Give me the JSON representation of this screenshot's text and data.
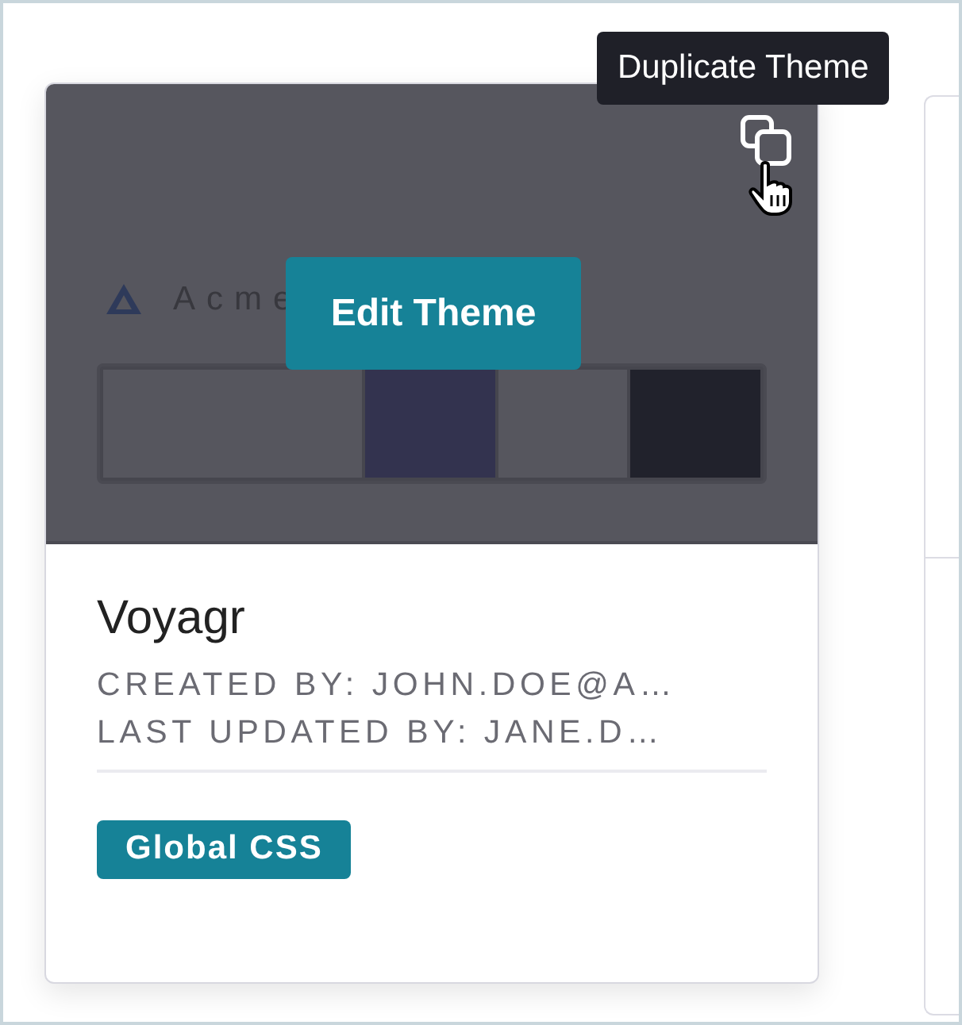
{
  "tooltip": {
    "text": "Duplicate Theme"
  },
  "theme_card": {
    "logo_text": "Acme",
    "edit_button": "Edit Theme",
    "palette": [
      {
        "color": "#56565e"
      },
      {
        "color": "#33334f"
      },
      {
        "color": "#56565e"
      },
      {
        "color": "#21222c"
      }
    ],
    "name": "Voyagr",
    "created_by": "CREATED BY: JOHN.DOE@A…",
    "last_updated_by": "LAST UPDATED BY: JANE.D…",
    "tag": "Global CSS"
  }
}
